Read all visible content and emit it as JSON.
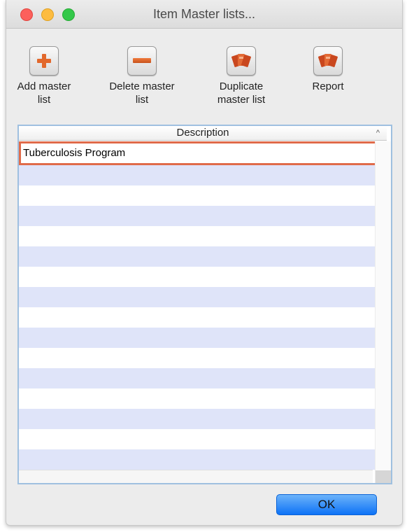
{
  "window": {
    "title": "Item Master lists..."
  },
  "toolbar": {
    "add_label": "Add master\nlist",
    "delete_label": "Delete master\nlist",
    "duplicate_label": "Duplicate\nmaster list",
    "report_label": "Report"
  },
  "icons": {
    "add": "plus-icon",
    "delete": "minus-icon",
    "duplicate": "cards-icon",
    "report": "cards-icon"
  },
  "table": {
    "column_header": "Description",
    "sort_indicator": "^",
    "rows": [
      "Tuberculosis Program"
    ],
    "selected_row": 0
  },
  "footer": {
    "ok_label": "OK"
  },
  "colors": {
    "accent": "#0d72f6",
    "selection_outline": "#e06b4a",
    "stripe": "#dfe4f9",
    "icon_orange": "#e2682c"
  }
}
